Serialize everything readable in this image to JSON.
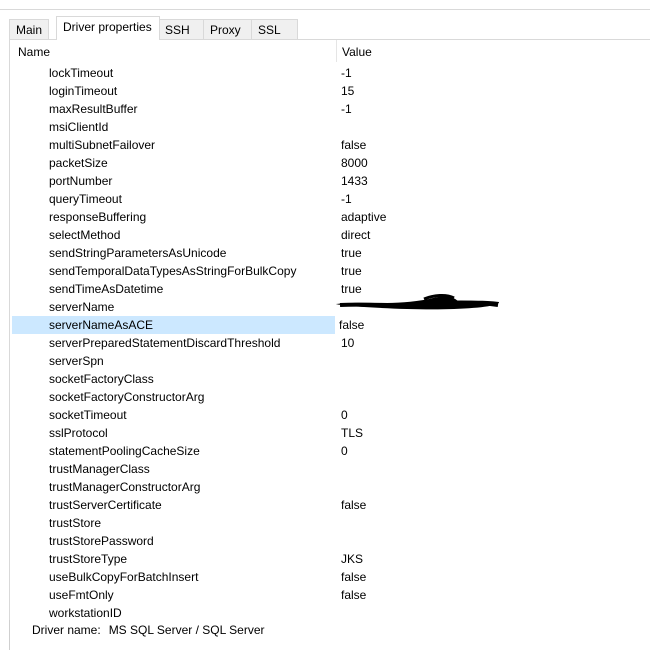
{
  "tabs": [
    {
      "label": "Main",
      "active": false
    },
    {
      "label": "Driver properties",
      "active": true
    },
    {
      "label": "SSH",
      "active": false
    },
    {
      "label": "Proxy",
      "active": false
    },
    {
      "label": "SSL",
      "active": false
    }
  ],
  "columns": {
    "name": "Name",
    "value": "Value"
  },
  "properties": [
    {
      "name": "lockTimeout",
      "value": "-1"
    },
    {
      "name": "loginTimeout",
      "value": "15"
    },
    {
      "name": "maxResultBuffer",
      "value": "-1"
    },
    {
      "name": "msiClientId",
      "value": ""
    },
    {
      "name": "multiSubnetFailover",
      "value": "false"
    },
    {
      "name": "packetSize",
      "value": "8000"
    },
    {
      "name": "portNumber",
      "value": "1433"
    },
    {
      "name": "queryTimeout",
      "value": "-1"
    },
    {
      "name": "responseBuffering",
      "value": "adaptive"
    },
    {
      "name": "selectMethod",
      "value": "direct"
    },
    {
      "name": "sendStringParametersAsUnicode",
      "value": "true"
    },
    {
      "name": "sendTemporalDataTypesAsStringForBulkCopy",
      "value": "true"
    },
    {
      "name": "sendTimeAsDatetime",
      "value": "true"
    },
    {
      "name": "serverName",
      "value": ""
    },
    {
      "name": "serverNameAsACE",
      "value": "false",
      "selected": true
    },
    {
      "name": "serverPreparedStatementDiscardThreshold",
      "value": "10"
    },
    {
      "name": "serverSpn",
      "value": ""
    },
    {
      "name": "socketFactoryClass",
      "value": ""
    },
    {
      "name": "socketFactoryConstructorArg",
      "value": ""
    },
    {
      "name": "socketTimeout",
      "value": "0"
    },
    {
      "name": "sslProtocol",
      "value": "TLS"
    },
    {
      "name": "statementPoolingCacheSize",
      "value": "0"
    },
    {
      "name": "trustManagerClass",
      "value": ""
    },
    {
      "name": "trustManagerConstructorArg",
      "value": ""
    },
    {
      "name": "trustServerCertificate",
      "value": "false"
    },
    {
      "name": "trustStore",
      "value": ""
    },
    {
      "name": "trustStorePassword",
      "value": ""
    },
    {
      "name": "trustStoreType",
      "value": "JKS"
    },
    {
      "name": "useBulkCopyForBatchInsert",
      "value": "false"
    },
    {
      "name": "useFmtOnly",
      "value": "false"
    },
    {
      "name": "workstationID",
      "value": ""
    }
  ],
  "footer": {
    "label": "Driver name:",
    "value": "MS SQL Server / SQL Server"
  },
  "colors": {
    "selection": "#cce8ff",
    "border": "#d9d9d9",
    "redaction": "#000000"
  }
}
